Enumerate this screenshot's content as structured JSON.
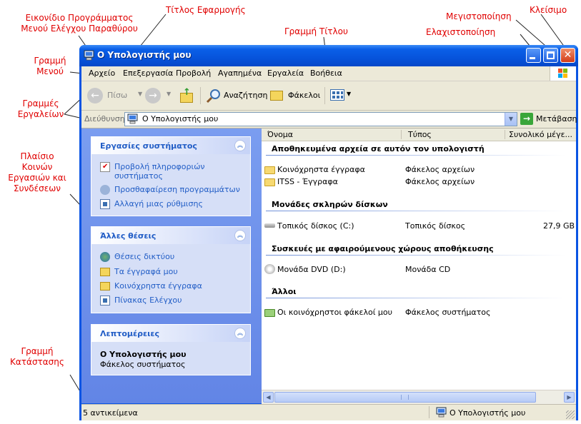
{
  "annotations": {
    "program_icon": "Εικονίδιο Προγράμματος Μενού Ελέγχου Παραθύρου",
    "program_icon_l1": "Εικονίδιο Προγράμματος",
    "program_icon_l2": "Μενού Ελέγχου Παραθύρου",
    "app_title": "Τίτλος Εφαρμογής",
    "title_bar": "Γραμμή Τίτλου",
    "maximize": "Μεγιστοποίηση",
    "minimize": "Ελαχιστοποίηση",
    "close": "Κλείσιμο",
    "menu_bar_l1": "Γραμμή",
    "menu_bar_l2": "Μενού",
    "toolbars_l1": "Γραμμές",
    "toolbars_l2": "Εργαλείων",
    "tasks_l1": "Πλαίσιο",
    "tasks_l2": "Κοινών",
    "tasks_l3": "Εργασιών και",
    "tasks_l4": "Συνδέσεων",
    "status_l1": "Γραμμή",
    "status_l2": "Κατάστασης"
  },
  "window": {
    "title": "Ο Υπολογιστής μου"
  },
  "menu": [
    "Αρχείο",
    "Επεξεργασία",
    "Προβολή",
    "Αγαπημένα",
    "Εργαλεία",
    "Βοήθεια"
  ],
  "toolbar": {
    "back": "Πίσω",
    "search": "Αναζήτηση",
    "folders": "Φάκελοι"
  },
  "address": {
    "label": "Διεύθυνση",
    "value": "Ο Υπολογιστής μου",
    "go": "Μετάβαση"
  },
  "tasks": {
    "system": {
      "title": "Εργασίες συστήματος",
      "links": [
        "Προβολή πληροφοριών συστήματος",
        "Προσθαφαίρεση προγραμμάτων",
        "Αλλαγή μιας ρύθμισης"
      ]
    },
    "other": {
      "title": "Άλλες θέσεις",
      "links": [
        "Θέσεις δικτύου",
        "Τα έγγραφά μου",
        "Κοινόχρηστα έγγραφα",
        "Πίνακας Ελέγχου"
      ]
    },
    "details": {
      "title": "Λεπτομέρειες",
      "name": "Ο Υπολογιστής μου",
      "type": "Φάκελος συστήματος"
    }
  },
  "columns": [
    "Όνομα",
    "Τύπος",
    "Συνολικό μέγε..."
  ],
  "groups": {
    "stored": "Αποθηκευμένα αρχεία σε αυτόν τον υπολογιστή",
    "hdd": "Μονάδες σκληρών δίσκων",
    "removable": "Συσκευές με αφαιρούμενους χώρους αποθήκευσης",
    "other": "Άλλοι"
  },
  "items": {
    "shared": {
      "name": "Κοινόχρηστα έγγραφα",
      "type": "Φάκελος αρχείων"
    },
    "itss": {
      "name": "ITSS - Έγγραφα",
      "type": "Φάκελος αρχείων"
    },
    "local": {
      "name": "Τοπικός δίσκος (C:)",
      "type": "Τοπικός δίσκος",
      "size": "27,9 GB"
    },
    "dvd": {
      "name": "Μονάδα DVD (D:)",
      "type": "Μονάδα CD"
    },
    "myshared": {
      "name": "Οι κοινόχρηστοι φάκελοί μου",
      "type": "Φάκελος συστήματος"
    }
  },
  "status": {
    "count": "5 αντικείμενα",
    "location": "Ο Υπολογιστής μου"
  },
  "colors": {
    "title_blue": "#0a54e3",
    "link_blue": "#215dc6",
    "annotation_red": "#e00000"
  }
}
